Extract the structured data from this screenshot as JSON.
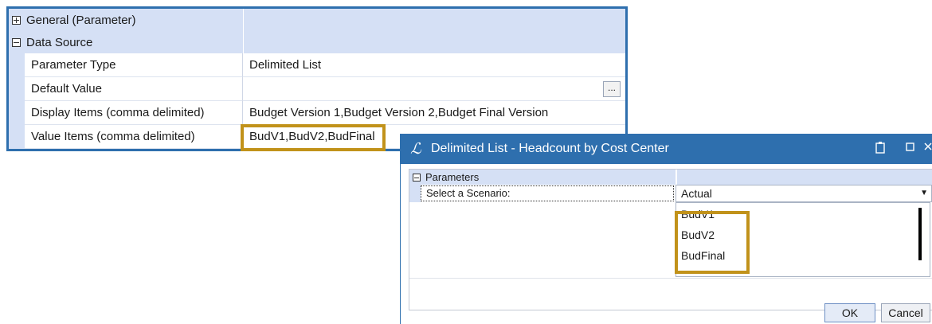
{
  "property_grid": {
    "categories": [
      {
        "label": "General (Parameter)",
        "expanded": false
      },
      {
        "label": "Data Source",
        "expanded": true
      }
    ],
    "properties": [
      {
        "name": "Parameter Type",
        "value": "Delimited List"
      },
      {
        "name": "Default Value",
        "value": ""
      },
      {
        "name": "Display Items (comma delimited)",
        "value": "Budget Version 1,Budget Version 2,Budget Final Version"
      },
      {
        "name": "Value Items (comma delimited)",
        "value": "BudV1,BudV2,BudFinal"
      }
    ],
    "ellipsis_label": "..."
  },
  "dialog": {
    "title": "Delimited List - Headcount by Cost Center",
    "logo_glyph": "ℒ",
    "category_label": "Parameters",
    "param_label": "Select a Scenario:",
    "selected_value": "Actual",
    "options": [
      "BudV1",
      "BudV2",
      "BudFinal"
    ],
    "ok_label": "OK",
    "cancel_label": "Cancel"
  },
  "colors": {
    "accent": "#2e6fae",
    "category_bg": "#d5e0f5",
    "highlight": "#c1921a"
  },
  "icons": [
    "expand-plus-icon",
    "collapse-minus-icon",
    "app-logo-icon",
    "clipboard-icon",
    "maximize-icon",
    "close-icon",
    "dropdown-arrow-icon"
  ]
}
